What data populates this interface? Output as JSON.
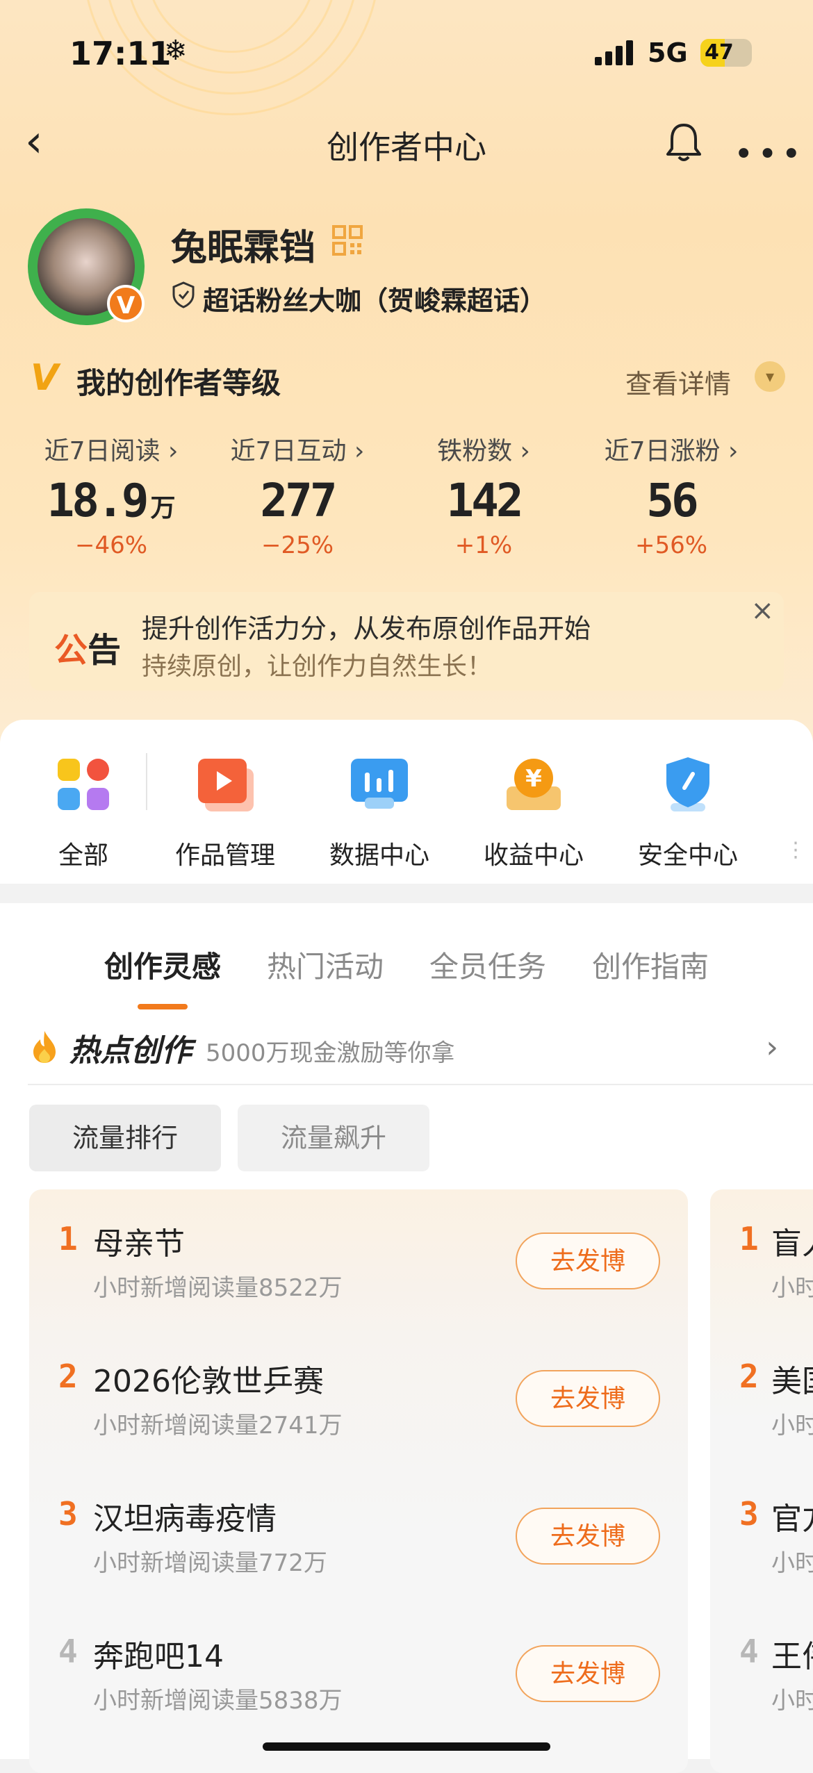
{
  "status": {
    "time": "17:11",
    "network": "5G",
    "battery": "47"
  },
  "nav": {
    "title": "创作者中心"
  },
  "profile": {
    "name": "兔眠霖铛",
    "subtitle": "超话粉丝大咖（贺峻霖超话）"
  },
  "level": {
    "label": "我的创作者等级",
    "detail": "查看详情"
  },
  "stats": [
    {
      "label": "近7日阅读 ›",
      "value": "18.9",
      "unit": "万",
      "change": "−46%"
    },
    {
      "label": "近7日互动 ›",
      "value": "277",
      "unit": "",
      "change": "−25%"
    },
    {
      "label": "铁粉数 ›",
      "value": "142",
      "unit": "",
      "change": "+1%"
    },
    {
      "label": "近7日涨粉 ›",
      "value": "56",
      "unit": "",
      "change": "+56%"
    }
  ],
  "notice": {
    "tag_a": "公",
    "tag_b": "告",
    "line1": "提升创作活力分，从发布原创作品开始",
    "line2": "持续原创，让创作力自然生长！"
  },
  "tools": [
    {
      "label": "全部",
      "icon": "grid-icon"
    },
    {
      "label": "作品管理",
      "icon": "play-icon"
    },
    {
      "label": "数据中心",
      "icon": "chart-icon"
    },
    {
      "label": "收益中心",
      "icon": "yuan-coin-icon"
    },
    {
      "label": "安全中心",
      "icon": "shield-icon"
    }
  ],
  "tabs": [
    "创作灵感",
    "热门活动",
    "全员任务",
    "创作指南"
  ],
  "hot": {
    "title": "热点创作",
    "subtitle": "5000万现金激励等你拿"
  },
  "chips": [
    "流量排行",
    "流量飙升"
  ],
  "ranking": [
    {
      "rank": "1",
      "title": "母亲节",
      "sub": "小时新增阅读量8522万",
      "btn": "去发博"
    },
    {
      "rank": "2",
      "title": "2026伦敦世乒赛",
      "sub": "小时新增阅读量2741万",
      "btn": "去发博"
    },
    {
      "rank": "3",
      "title": "汉坦病毒疫情",
      "sub": "小时新增阅读量772万",
      "btn": "去发博"
    },
    {
      "rank": "4",
      "title": "奔跑吧14",
      "sub": "小时新增阅读量5838万",
      "btn": "去发博"
    }
  ],
  "ranking2": [
    {
      "rank": "1",
      "title": "盲人",
      "sub": "小时"
    },
    {
      "rank": "2",
      "title": "美国",
      "sub": "小时"
    },
    {
      "rank": "3",
      "title": "官方",
      "sub": "小时"
    },
    {
      "rank": "4",
      "title": "王伟",
      "sub": "小时"
    }
  ],
  "colors": {
    "accent": "#f27a1c",
    "hero": "#fde1b4",
    "up": "#e05a24"
  }
}
